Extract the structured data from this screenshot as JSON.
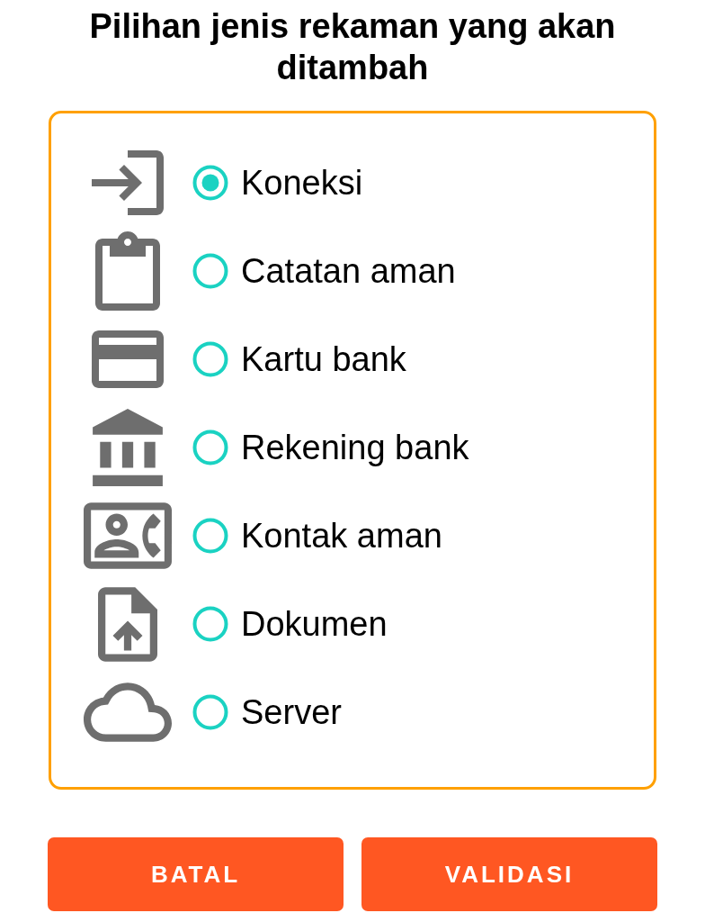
{
  "title": "Pilihan jenis rekaman yang akan ditambah",
  "options": [
    {
      "label": "Koneksi",
      "selected": true
    },
    {
      "label": "Catatan aman",
      "selected": false
    },
    {
      "label": "Kartu bank",
      "selected": false
    },
    {
      "label": "Rekening bank",
      "selected": false
    },
    {
      "label": "Kontak aman",
      "selected": false
    },
    {
      "label": "Dokumen",
      "selected": false
    },
    {
      "label": "Server",
      "selected": false
    }
  ],
  "buttons": [
    {
      "label": "BATAL"
    },
    {
      "label": "VALIDASI"
    }
  ]
}
